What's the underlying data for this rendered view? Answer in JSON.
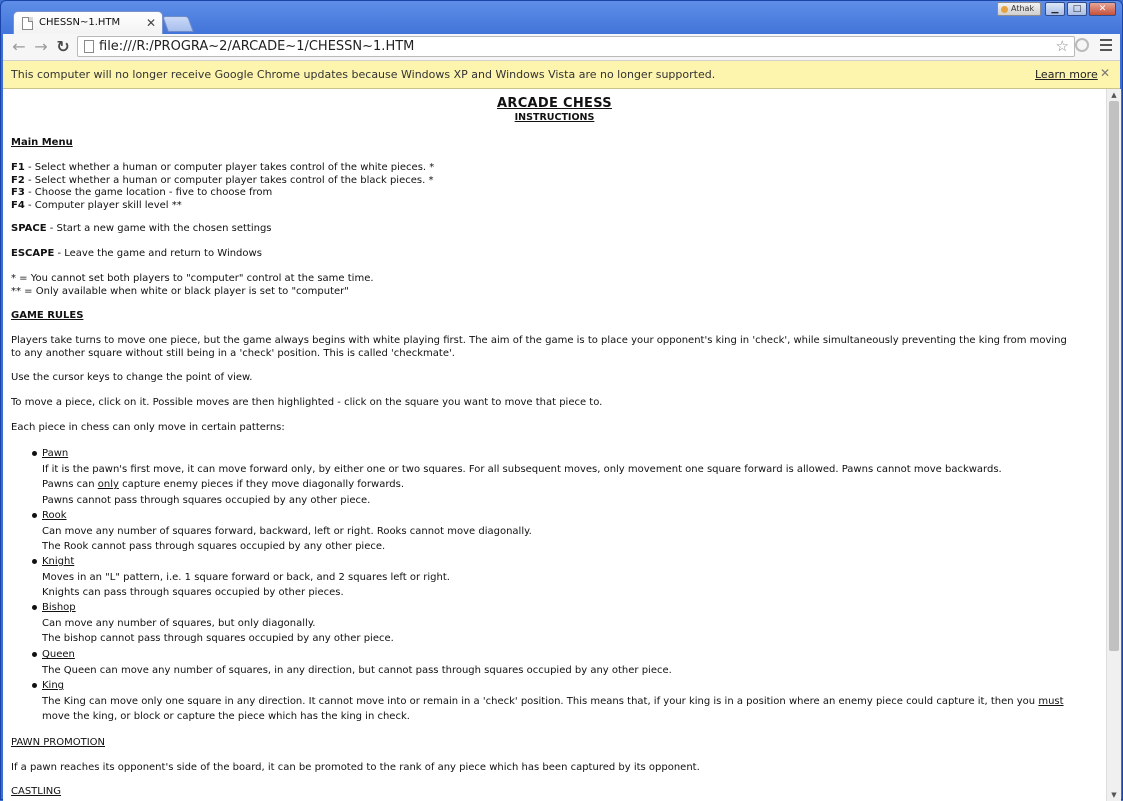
{
  "tab": {
    "title": "CHESSN~1.HTM"
  },
  "window": {
    "user": "Athak"
  },
  "toolbar": {
    "url": "file:///R:/PROGRA~2/ARCADE~1/CHESSN~1.HTM"
  },
  "infobar": {
    "text": "This computer will no longer receive Google Chrome updates because Windows XP and Windows Vista are no longer supported.",
    "link": "Learn more"
  },
  "doc": {
    "title": "ARCADE CHESS",
    "subtitle": "INSTRUCTIONS",
    "main_menu": {
      "heading": "Main Menu",
      "keys": [
        {
          "key": "F1",
          "desc": " - Select whether a human or computer player takes control of the white pieces. *"
        },
        {
          "key": "F2",
          "desc": " - Select whether a human or computer player takes control of the black pieces. *"
        },
        {
          "key": "F3",
          "desc": " - Choose the game location - five to choose from"
        },
        {
          "key": "F4",
          "desc": " - Computer player skill level **"
        }
      ],
      "space": {
        "key": "SPACE",
        "desc": " - Start a new game with the chosen settings"
      },
      "escape": {
        "key": "ESCAPE",
        "desc": " - Leave the game and return to Windows"
      },
      "note1": "* = You cannot set both players to \"computer\" control at the same time.",
      "note2": "** = Only available when white or black player is set to \"computer\""
    },
    "rules": {
      "heading": "GAME RULES",
      "p1a": "Players take turns to move one piece, but the game always begins with white playing first.  The aim of the game is to place your opponent's king in 'check', while simultaneously preventing the king from moving",
      "p1b": "to any another square without still being in a 'check' position.  This is called 'checkmate'.",
      "p2": "Use the cursor keys to change the point of view.",
      "p3": "To move a piece, click on it.  Possible moves are then highlighted - click on the square you want to move that piece to.",
      "p4": "Each piece in chess can only move in certain patterns:"
    },
    "pieces": {
      "pawn": {
        "name": "Pawn",
        "l1": "If it is the pawn's first move, it can move forward only, by either one or two squares.  For all subsequent moves, only movement one square forward is allowed.  Pawns cannot move backwards.",
        "l2a": "Pawns can ",
        "l2u": "only",
        "l2b": " capture enemy pieces if they move diagonally forwards.",
        "l3": "Pawns cannot pass through squares occupied by any other piece."
      },
      "rook": {
        "name": "Rook",
        "l1": "Can move any number of squares forward, backward, left or right.  Rooks cannot move diagonally.",
        "l2": "The Rook cannot pass through squares occupied by any other piece."
      },
      "knight": {
        "name": "Knight",
        "l1": "Moves in an \"L\" pattern, i.e. 1 square forward or back, and 2 squares left or right.",
        "l2": "Knights can pass through squares occupied by other pieces."
      },
      "bishop": {
        "name": "Bishop",
        "l1": "Can move any number of squares, but only diagonally.",
        "l2": "The bishop cannot pass through squares occupied by any other piece."
      },
      "queen": {
        "name": "Queen",
        "l1": "The Queen can move any number of squares, in any direction, but cannot pass through squares occupied by any other piece."
      },
      "king": {
        "name": "King",
        "l1a": "The King can move only one square in any direction.  It cannot move into or remain in a 'check' position.  This means that, if your king is in a position where an enemy piece could capture it, then you ",
        "l1u": "must",
        "l2": "move the king, or block or capture the piece which has the king in check."
      }
    },
    "promotion": {
      "heading": "PAWN PROMOTION",
      "text": "If a pawn reaches its opponent's side of the board, it can be promoted to the rank of any piece which has been captured by its opponent."
    },
    "castling": {
      "heading": "CASTLING"
    }
  }
}
